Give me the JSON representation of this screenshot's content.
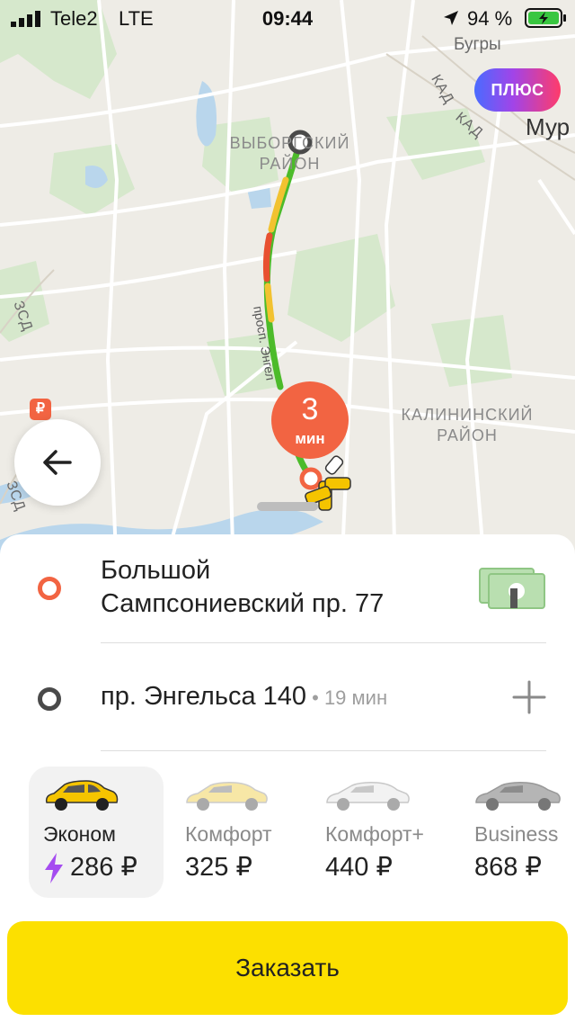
{
  "status_bar": {
    "carrier": "Tele2",
    "network": "LTE",
    "time": "09:44",
    "battery": "94 %"
  },
  "map": {
    "labels": {
      "bugry": "Бугры",
      "kad1": "КАД",
      "kad2": "КАД",
      "murino": "Мур",
      "zsd1": "ЗСД",
      "zsd2": "ЗСД",
      "vyborgsky_line1": "ВЫБОРГСКИЙ",
      "vyborgsky_line2": "РАЙОН",
      "kalininsky_line1": "КАЛИНИНСКИЙ",
      "kalininsky_line2": "РАЙОН",
      "route_street": "просп. Энгел"
    },
    "eta_value": "3",
    "eta_unit": "мин",
    "metro_glyph": "₽"
  },
  "plus_badge": "ПЛЮС",
  "route": {
    "from": {
      "line1": "Большой",
      "line2": "Сампсониевский пр. 77"
    },
    "to": {
      "address": "пр. Энгельса 140",
      "time": " • 19 мин"
    }
  },
  "tariffs": [
    {
      "name": "Эконом",
      "price": "286 ₽",
      "selected": true
    },
    {
      "name": "Комфорт",
      "price": "325 ₽",
      "selected": false
    },
    {
      "name": "Комфорт+",
      "price": "440 ₽",
      "selected": false
    },
    {
      "name": "Business",
      "price": "868 ₽",
      "selected": false
    }
  ],
  "order_button": "Заказать",
  "colors": {
    "accent_yellow": "#fce000",
    "route_orange": "#f26442",
    "plus_gradient": [
      "#4a6bff",
      "#a144e8",
      "#ff3c6a"
    ]
  }
}
